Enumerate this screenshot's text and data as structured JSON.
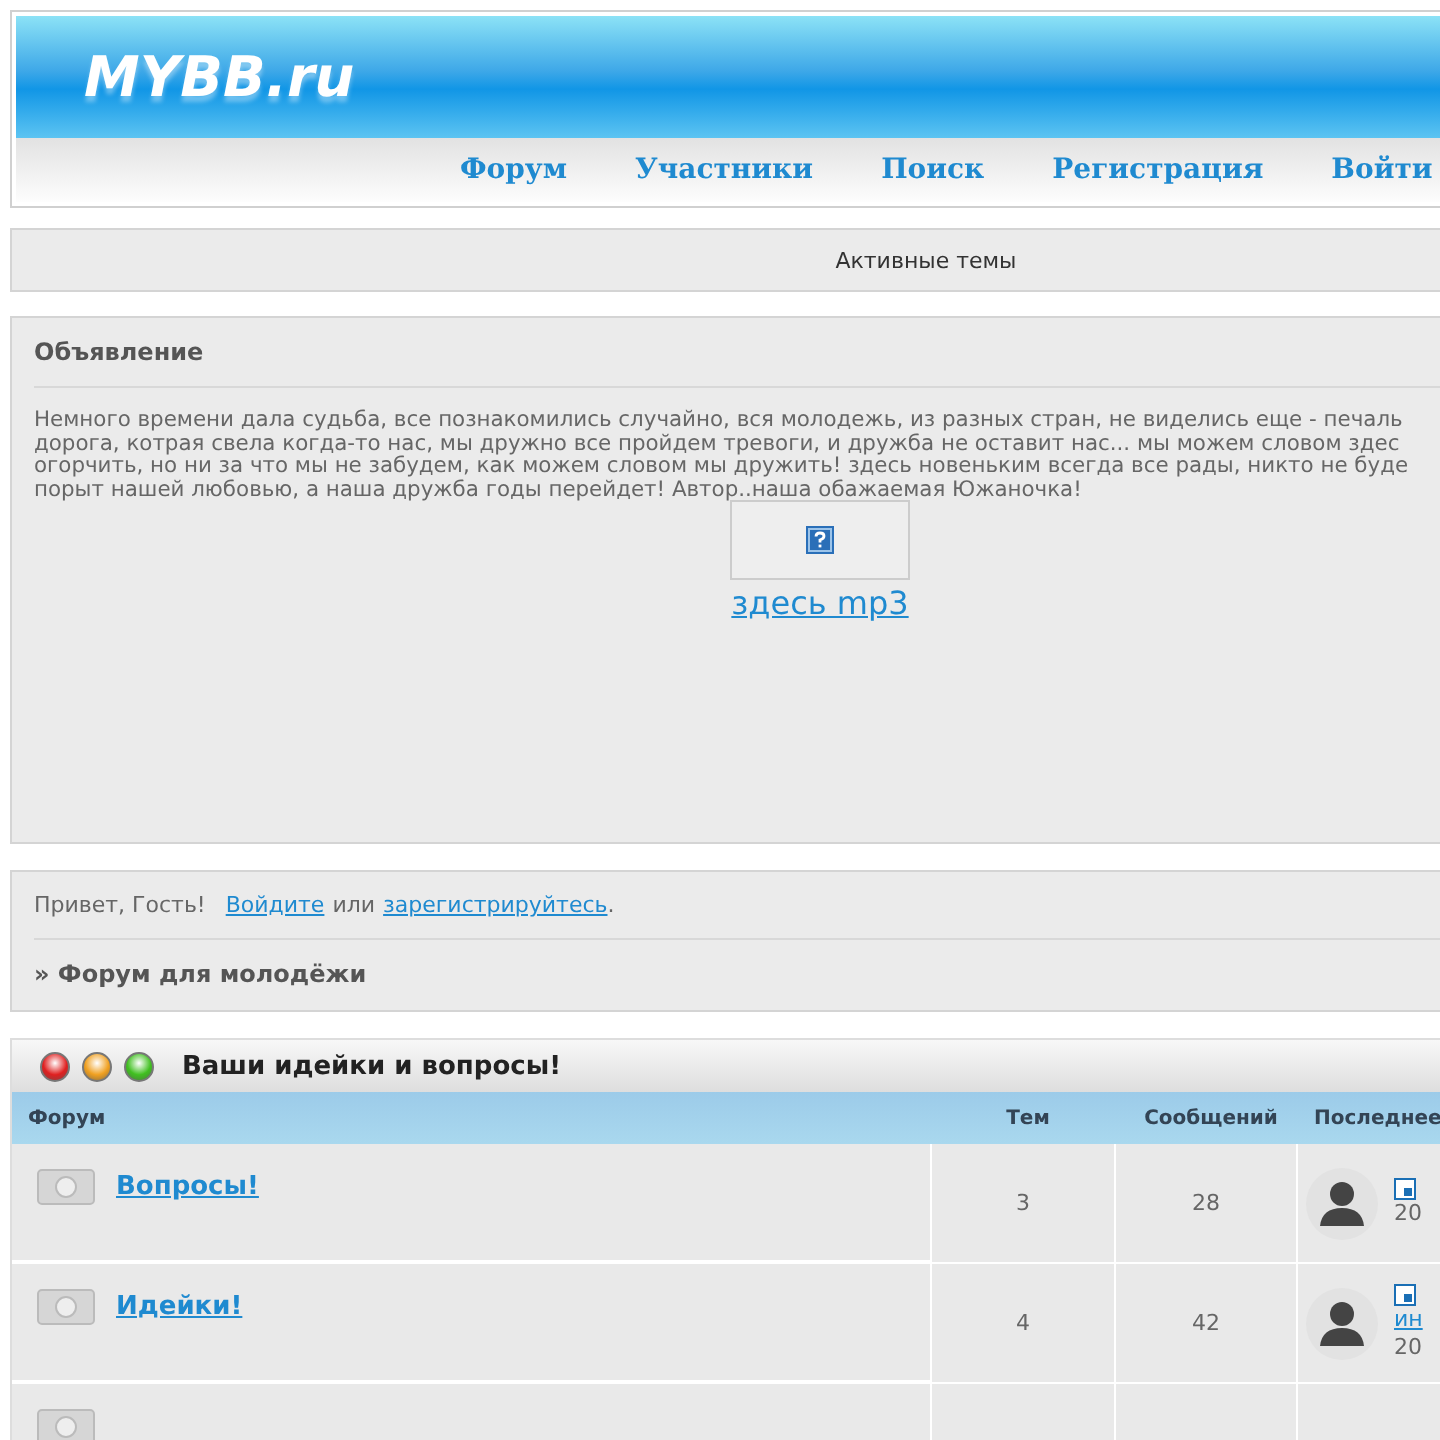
{
  "header": {
    "logo": "MYBB.ru",
    "nav": [
      "Форум",
      "Участники",
      "Поиск",
      "Регистрация",
      "Войти"
    ]
  },
  "active_topics": "Активные темы",
  "announcement": {
    "title": "Объявление",
    "lines": [
      "Немного времени дала судьба, все познакомились случайно, вся молодежь, из разных стран, не виделись еще - печаль",
      "дорога, котрая свела когда-то нас, мы дружно все пройдем тревоги, и дружба не оставит нас... мы можем словом здес",
      "огорчить, но ни за что мы не забудем, как можем словом мы дружить! здесь новеньким всегда все рады, никто не буде",
      "порыт нашей любовью, а наша дружба годы перейдет! Автор..наша обажаемая Южаночка!"
    ],
    "link": "здесь mp3"
  },
  "welcome": {
    "greeting": "Привет, Гость!",
    "login": "Войдите",
    "or": "или",
    "register": "зарегистрируйтесь",
    "end": ".",
    "breadcrumb": "» Форум для молодёжи"
  },
  "category": {
    "title": "Ваши идейки и вопросы!",
    "columns": [
      "Форум",
      "Тем",
      "Сообщений",
      "Последнее"
    ],
    "rows": [
      {
        "name": "Вопросы!",
        "topics": "3",
        "posts": "28",
        "last_link": "",
        "last_date": "20"
      },
      {
        "name": "Идейки!",
        "topics": "4",
        "posts": "42",
        "last_link": "ин",
        "last_date": "20"
      }
    ]
  }
}
